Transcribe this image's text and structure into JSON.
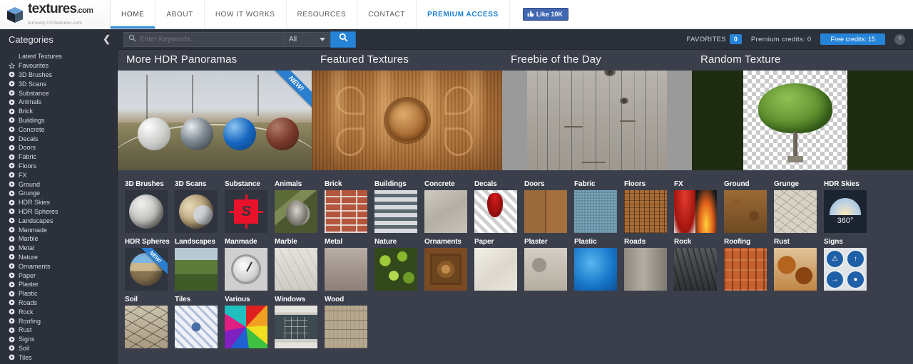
{
  "brand": {
    "logo_main": "textures",
    "logo_tld": ".com",
    "logo_sub": "formerly CGTextures.com",
    "cube_icon": "cube-icon"
  },
  "topnav": {
    "items": [
      {
        "label": "HOME",
        "active": true
      },
      {
        "label": "ABOUT",
        "active": false
      },
      {
        "label": "HOW IT WORKS",
        "active": false
      },
      {
        "label": "RESOURCES",
        "active": false
      },
      {
        "label": "CONTACT",
        "active": false
      },
      {
        "label": "PREMIUM ACCESS",
        "active": false,
        "premium": true
      }
    ],
    "facebook_like": "Like 10K",
    "facebook_color": "#4267b2"
  },
  "header": {
    "categories_title": "Categories",
    "collapse_icon": "chevron-left-icon",
    "search": {
      "placeholder": "Enter Keywords...",
      "value": "",
      "scope": "All",
      "search_icon": "search-icon",
      "button_icon": "search-icon"
    },
    "favorites_label": "FAVORITES",
    "favorites_count": "0",
    "premium_credits": "Premium credits: 0",
    "free_credits": "Free credits: 15",
    "help_icon": "question-mark-icon",
    "accent_color": "#2684d8"
  },
  "sidebar": {
    "items": [
      {
        "label": "Latest Textures",
        "icon": "none"
      },
      {
        "label": "Favourites",
        "icon": "star-icon"
      },
      {
        "label": "3D Brushes",
        "icon": "arrow-circle-icon"
      },
      {
        "label": "3D Scans",
        "icon": "arrow-circle-icon"
      },
      {
        "label": "Substance",
        "icon": "arrow-circle-icon"
      },
      {
        "label": "Animals",
        "icon": "arrow-circle-icon"
      },
      {
        "label": "Brick",
        "icon": "arrow-circle-icon"
      },
      {
        "label": "Buildings",
        "icon": "arrow-circle-icon"
      },
      {
        "label": "Concrete",
        "icon": "arrow-circle-icon"
      },
      {
        "label": "Decals",
        "icon": "arrow-circle-icon"
      },
      {
        "label": "Doors",
        "icon": "arrow-circle-icon"
      },
      {
        "label": "Fabric",
        "icon": "arrow-circle-icon"
      },
      {
        "label": "Floors",
        "icon": "arrow-circle-icon"
      },
      {
        "label": "FX",
        "icon": "arrow-circle-icon"
      },
      {
        "label": "Ground",
        "icon": "arrow-circle-icon"
      },
      {
        "label": "Grunge",
        "icon": "arrow-circle-icon"
      },
      {
        "label": "HDR Skies",
        "icon": "arrow-circle-icon"
      },
      {
        "label": "HDR Spheres",
        "icon": "arrow-circle-icon"
      },
      {
        "label": "Landscapes",
        "icon": "arrow-circle-icon"
      },
      {
        "label": "Manmade",
        "icon": "arrow-circle-icon"
      },
      {
        "label": "Marble",
        "icon": "arrow-circle-icon"
      },
      {
        "label": "Metal",
        "icon": "arrow-circle-icon"
      },
      {
        "label": "Nature",
        "icon": "arrow-circle-icon"
      },
      {
        "label": "Ornaments",
        "icon": "arrow-circle-icon"
      },
      {
        "label": "Paper",
        "icon": "arrow-circle-icon"
      },
      {
        "label": "Plaster",
        "icon": "arrow-circle-icon"
      },
      {
        "label": "Plastic",
        "icon": "arrow-circle-icon"
      },
      {
        "label": "Roads",
        "icon": "arrow-circle-icon"
      },
      {
        "label": "Rock",
        "icon": "arrow-circle-icon"
      },
      {
        "label": "Roofing",
        "icon": "arrow-circle-icon"
      },
      {
        "label": "Rust",
        "icon": "arrow-circle-icon"
      },
      {
        "label": "Signs",
        "icon": "arrow-circle-icon"
      },
      {
        "label": "Soil",
        "icon": "arrow-circle-icon"
      },
      {
        "label": "Tiles",
        "icon": "arrow-circle-icon"
      }
    ]
  },
  "banners": [
    {
      "title": "More HDR Panoramas",
      "badge": "NEW!"
    },
    {
      "title": "Featured Textures",
      "badge": ""
    },
    {
      "title": "Freebie of the Day",
      "badge": ""
    },
    {
      "title": "Random Texture",
      "badge": ""
    }
  ],
  "hdr_sky_badge": "360°",
  "grid": {
    "rows": [
      [
        {
          "label": "3D Brushes",
          "art": "t-sphere-gray",
          "badge": ""
        },
        {
          "label": "3D Scans",
          "art": "t-sphere-rock",
          "badge": ""
        },
        {
          "label": "Substance",
          "art": "t-substance",
          "badge": ""
        },
        {
          "label": "Animals",
          "art": "t-gorilla",
          "badge": ""
        },
        {
          "label": "Brick",
          "art": "t-brick",
          "badge": ""
        },
        {
          "label": "Buildings",
          "art": "t-buildings",
          "badge": ""
        },
        {
          "label": "Concrete",
          "art": "t-concrete",
          "badge": ""
        },
        {
          "label": "Decals",
          "art": "t-decals",
          "badge": ""
        },
        {
          "label": "Doors",
          "art": "t-doors",
          "badge": ""
        },
        {
          "label": "Fabric",
          "art": "t-fabric",
          "badge": ""
        },
        {
          "label": "Floors",
          "art": "t-floors",
          "badge": ""
        },
        {
          "label": "FX",
          "art": "t-fx",
          "badge": ""
        },
        {
          "label": "Ground",
          "art": "t-ground",
          "badge": ""
        },
        {
          "label": "Grunge",
          "art": "t-grunge",
          "badge": ""
        },
        {
          "label": "HDR Skies",
          "art": "t-hdrsky",
          "badge": ""
        }
      ],
      [
        {
          "label": "HDR Spheres",
          "art": "t-hdrsphere",
          "badge": "NEW!"
        },
        {
          "label": "Landscapes",
          "art": "t-landscape",
          "badge": ""
        },
        {
          "label": "Manmade",
          "art": "t-manmade",
          "badge": ""
        },
        {
          "label": "Marble",
          "art": "t-marble",
          "badge": ""
        },
        {
          "label": "Metal",
          "art": "t-metal",
          "badge": ""
        },
        {
          "label": "Nature",
          "art": "t-nature",
          "badge": ""
        },
        {
          "label": "Ornaments",
          "art": "t-ornaments",
          "badge": ""
        },
        {
          "label": "Paper",
          "art": "t-paper",
          "badge": ""
        },
        {
          "label": "Plaster",
          "art": "t-plaster",
          "badge": ""
        },
        {
          "label": "Plastic",
          "art": "t-plastic",
          "badge": ""
        },
        {
          "label": "Roads",
          "art": "t-roads",
          "badge": ""
        },
        {
          "label": "Rock",
          "art": "t-rock",
          "badge": ""
        },
        {
          "label": "Roofing",
          "art": "t-roofing",
          "badge": ""
        },
        {
          "label": "Rust",
          "art": "t-rust",
          "badge": ""
        },
        {
          "label": "Signs",
          "art": "t-signs",
          "badge": ""
        }
      ],
      [
        {
          "label": "Soil",
          "art": "t-soil",
          "badge": ""
        },
        {
          "label": "Tiles",
          "art": "t-tiles",
          "badge": ""
        },
        {
          "label": "Various",
          "art": "t-various",
          "badge": ""
        },
        {
          "label": "Windows",
          "art": "t-windows",
          "badge": ""
        },
        {
          "label": "Wood",
          "art": "t-wood",
          "badge": ""
        }
      ]
    ]
  }
}
